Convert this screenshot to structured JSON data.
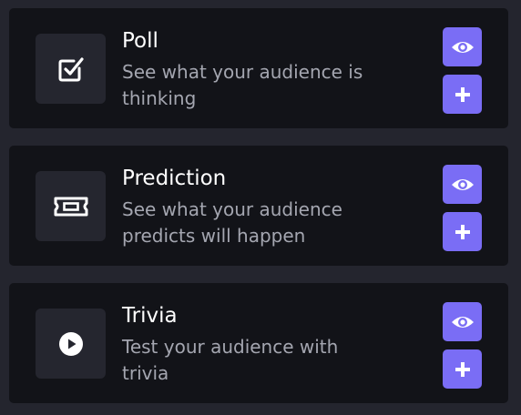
{
  "cards": [
    {
      "title": "Poll",
      "description": "See what your audience is thinking",
      "icon": "checkbox-icon"
    },
    {
      "title": "Prediction",
      "description": "See what your audience predicts will happen",
      "icon": "ticket-icon"
    },
    {
      "title": "Trivia",
      "description": "Test your audience with trivia",
      "icon": "play-circle-icon"
    }
  ],
  "buttons": {
    "view_icon": "eye-icon",
    "add_icon": "plus-icon"
  },
  "colors": {
    "page_background": "#24252e",
    "card_background": "#121318",
    "icon_tile_background": "#25262f",
    "accent": "#7a6df5",
    "title_text": "#ffffff",
    "description_text": "#a4a6b0"
  }
}
